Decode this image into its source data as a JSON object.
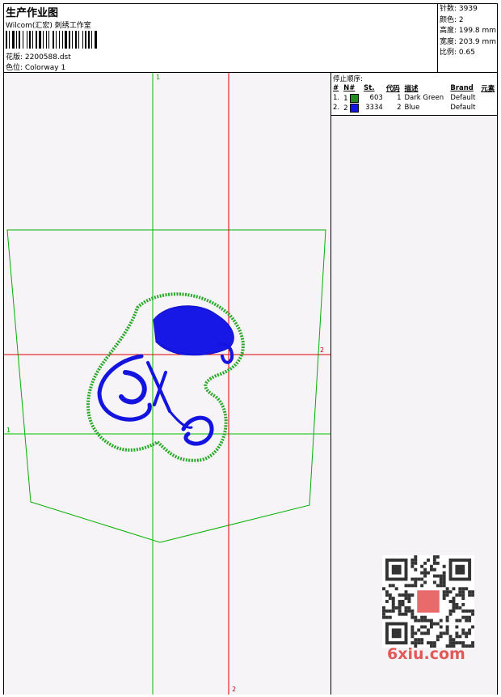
{
  "header": {
    "title": "生产作业图",
    "company": "Wilcom(汇宏) 刺绣工作室",
    "design_label": "花版: 2200588.dst",
    "colorway_label": "色位: Colorway 1"
  },
  "stats": {
    "stitches": "针数: 3939",
    "colors": "颜色: 2",
    "height": "高度: 199.8 mm",
    "width": "宽度: 203.9 mm",
    "scale": "比例: 0.65"
  },
  "stop_sequence": {
    "title": "停止顺序:",
    "headers": [
      "#",
      "N#",
      "St.",
      "代码",
      "描述",
      "Brand",
      "元素"
    ],
    "rows": [
      {
        "index": "1.",
        "needle": "1",
        "stitches": "603",
        "code": "1",
        "description": "Dark Green",
        "brand": "Default",
        "color": "#1f8f1f"
      },
      {
        "index": "2.",
        "needle": "2",
        "stitches": "3334",
        "code": "2",
        "description": "Blue",
        "brand": "Default",
        "color": "#1414e0"
      }
    ]
  },
  "markers": {
    "green_top": "1",
    "green_left": "1",
    "red_right": "2",
    "red_bottom": "2"
  },
  "watermark": "6xiu.com",
  "colors": {
    "green_guides": "#00c000",
    "red_guides": "#e00000",
    "pocket_outline": "#00b000",
    "embroidery_blue": "#1414e0",
    "satin_green": "#2aa82a"
  }
}
